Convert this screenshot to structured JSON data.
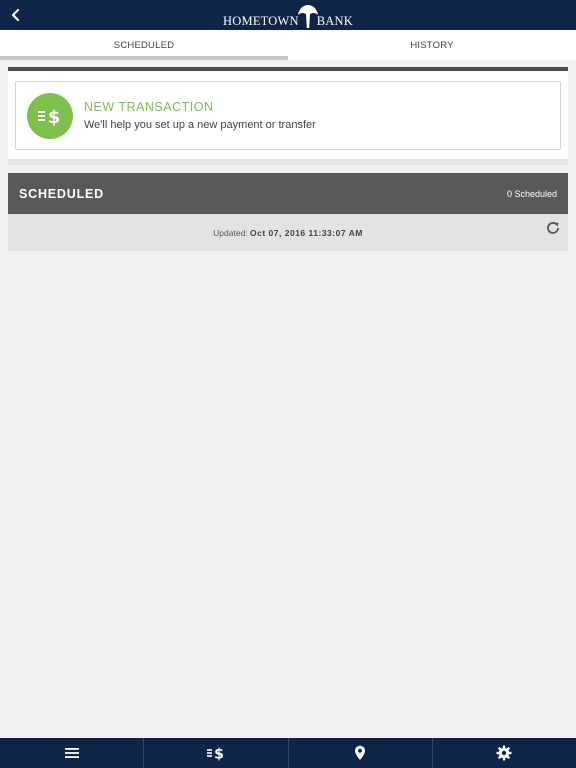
{
  "header": {
    "logo_left": "HOMETOWN",
    "logo_right": "BANK"
  },
  "tabs": [
    {
      "label": "SCHEDULED",
      "active": true
    },
    {
      "label": "HISTORY",
      "active": false
    }
  ],
  "new_transaction": {
    "title": "NEW TRANSACTION",
    "subtitle": "We'll help you set up a new payment or transfer",
    "icon": "transfer-dollar-icon"
  },
  "scheduled": {
    "title": "SCHEDULED",
    "count": "0 Scheduled",
    "updated_label": "Updated:",
    "updated_value": "Oct 07, 2016 11:33:07 AM"
  },
  "bottom_nav": [
    {
      "name": "menu",
      "icon": "hamburger-menu-icon"
    },
    {
      "name": "transfers",
      "icon": "transfer-dollar-icon"
    },
    {
      "name": "locations",
      "icon": "location-pin-icon"
    },
    {
      "name": "settings",
      "icon": "gear-icon"
    }
  ],
  "colors": {
    "navy": "#0f2547",
    "green": "#7dc04b",
    "dark_gray": "#595959"
  }
}
